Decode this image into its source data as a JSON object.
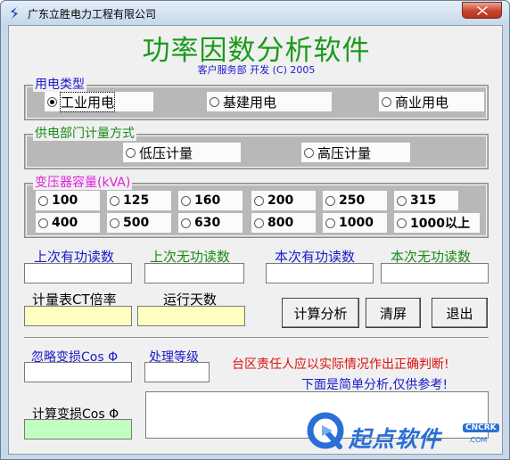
{
  "window": {
    "title": "广东立胜电力工程有限公司"
  },
  "header": {
    "title": "功率因数分析软件",
    "subtitle": "客户服务部 开发 (C) 2005"
  },
  "usage_type": {
    "label": "用电类型",
    "options": [
      "工业用电",
      "基建用电",
      "商业用电"
    ],
    "selected": "工业用电"
  },
  "metering": {
    "label": "供电部门计量方式",
    "options": [
      "低压计量",
      "高压计量"
    ]
  },
  "capacity": {
    "label": "变压器容量(kVA)",
    "options": [
      "100",
      "125",
      "160",
      "200",
      "250",
      "315",
      "400",
      "500",
      "630",
      "800",
      "1000",
      "1000以上"
    ]
  },
  "readings": {
    "last_active": "上次有功读数",
    "last_reactive": "上次无功读数",
    "current_active": "本次有功读数",
    "current_reactive": "本次无功读数",
    "ct_ratio": "计量表CT倍率",
    "run_days": "运行天数"
  },
  "buttons": {
    "calculate": "计算分析",
    "clear": "清屏",
    "exit": "退出"
  },
  "results": {
    "ignore_cos": "忽略变损Cos Φ",
    "level": "处理等级",
    "calc_cos": "计算变损Cos Φ",
    "warning": "台区责任人应以实际情况作出正确判断!",
    "note": "下面是简单分析,仅供参考!"
  },
  "watermark": {
    "brand": "起点软件",
    "tag": "CNCRK",
    "domain": ".COM"
  },
  "colors": {
    "title_green": "#1a9a1a",
    "label_blue": "#1a1acc",
    "warning_red": "#dd1010",
    "capacity_magenta": "#e020e0",
    "field_yellow": "#ffffc0",
    "field_green": "#c0ffc0"
  }
}
